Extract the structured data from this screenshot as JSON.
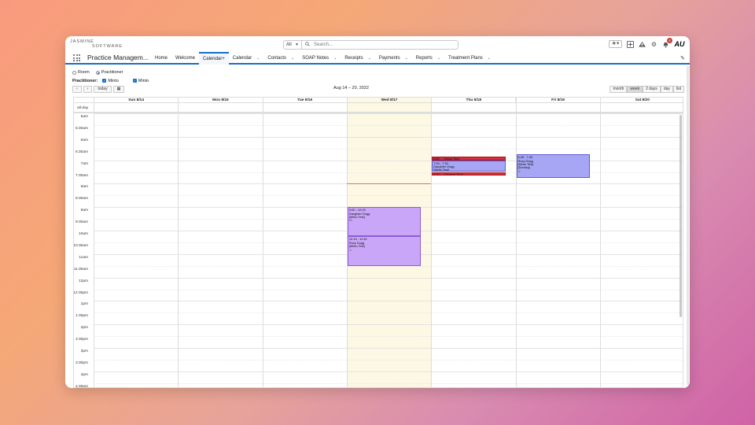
{
  "brand": {
    "line1": "JASMINE",
    "line2": "SOFTWARE"
  },
  "search": {
    "scope": "All",
    "placeholder": "Search..."
  },
  "header": {
    "notification_count": "5",
    "avatar_text": "AU"
  },
  "app": {
    "name": "Practice Managem..."
  },
  "tabs": [
    {
      "label": "Home",
      "has_menu": false
    },
    {
      "label": "Welcome",
      "has_menu": false
    },
    {
      "label": "Calendar+",
      "has_menu": false,
      "active": true
    },
    {
      "label": "Calendar",
      "has_menu": true
    },
    {
      "label": "Contacts",
      "has_menu": true
    },
    {
      "label": "SOAP Notes",
      "has_menu": true
    },
    {
      "label": "Receipts",
      "has_menu": true
    },
    {
      "label": "Payments",
      "has_menu": true
    },
    {
      "label": "Reports",
      "has_menu": true
    },
    {
      "label": "Treatment Plans",
      "has_menu": true
    }
  ],
  "filters": {
    "room_label": "Room",
    "practitioner_radio_label": "Practitioner",
    "practitioner_label": "Practitioner:",
    "checkbox1": "Minto",
    "checkbox2": "Minto"
  },
  "toolbar": {
    "prev": "‹",
    "next": "›",
    "today": "today",
    "calendar_icon": "▦"
  },
  "calendar": {
    "range_title": "Aug 14 – 20, 2022",
    "views": [
      "month",
      "week",
      "2 days",
      "day",
      "list"
    ],
    "active_view": "week",
    "allday_label": "all-day",
    "days": [
      "Sun 8/14",
      "Mon 8/15",
      "Tue 8/16",
      "Wed 8/17",
      "Thu 8/18",
      "Fri 8/19",
      "Sat 8/20"
    ],
    "today_index": 3,
    "times": [
      "5am",
      "5:30am",
      "6am",
      "6:30am",
      "7am",
      "7:30am",
      "8am",
      "8:30am",
      "9am",
      "9:30am",
      "10am",
      "10:30am",
      "11am",
      "11:30am",
      "12pm",
      "12:30pm",
      "1pm",
      "1:30pm",
      "2pm",
      "2:30pm",
      "3pm",
      "3:30pm",
      "4pm",
      "4:30pm"
    ],
    "now_marker": "7:59",
    "events": [
      {
        "day": 3,
        "start": "9:00",
        "end": "10:15",
        "time": "9:00 - 10:15",
        "title": "Daughter Dogg",
        "sub": "[Minto Test]",
        "icon": "☐",
        "color": "purple"
      },
      {
        "day": 3,
        "start": "10:15",
        "end": "11:30",
        "time": "10:15 - 11:30",
        "title": "Roxy Dogg",
        "sub": "[Minto Test]",
        "icon": "☆",
        "color": "purple"
      },
      {
        "day": 4,
        "start": "6:50",
        "end": "7:00",
        "time": "6:50",
        "title": "Setup Time",
        "sub": "",
        "icon": "",
        "color": "red"
      },
      {
        "day": 4,
        "start": "7:00",
        "end": "7:30",
        "time": "7:00 - 7:30",
        "title": "Daughter Dogg",
        "sub": "[Minto Test]",
        "icon": "",
        "color": "blue"
      },
      {
        "day": 4,
        "start": "7:30",
        "end": "7:40",
        "time": "7:30",
        "title": "Cleanup Time",
        "sub": "",
        "icon": "",
        "color": "red"
      },
      {
        "day": 5,
        "start": "6:45",
        "end": "7:45",
        "time": "6:45 - 7:45",
        "title": "Roxy Dogg",
        "sub": "[Minto Test]",
        "icon": "☆",
        "sub2": "[Donkey]",
        "color": "blue"
      }
    ]
  }
}
